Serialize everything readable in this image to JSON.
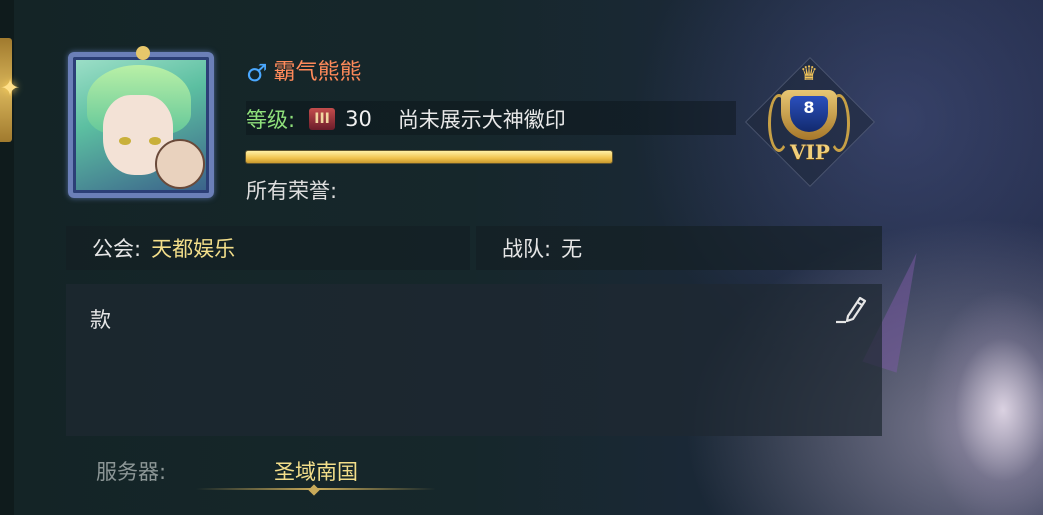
{
  "player": {
    "gender_icon": "male-icon",
    "gender_symbol": "♂",
    "name": "霸气熊熊",
    "name_color": "#ff8a5a"
  },
  "level": {
    "label": "等级:",
    "badge_icon": "level-rank-icon",
    "badge_glyph": "III",
    "value": "30",
    "badge_text": "尚未展示大神徽印",
    "xp_progress": 1.0
  },
  "honors": {
    "label": "所有荣誉:"
  },
  "vip": {
    "number": "8",
    "label": "VIP"
  },
  "guild": {
    "label": "公会:",
    "value": "天都娱乐"
  },
  "team": {
    "label": "战队:",
    "value": "无"
  },
  "signature": {
    "text": "款",
    "edit_icon": "edit-pencil-icon"
  },
  "server": {
    "label": "服务器:",
    "value": "圣域南国"
  },
  "colors": {
    "accent_gold": "#f3de8a",
    "level_green": "#8fe07b",
    "male_blue": "#4aa8ff"
  }
}
